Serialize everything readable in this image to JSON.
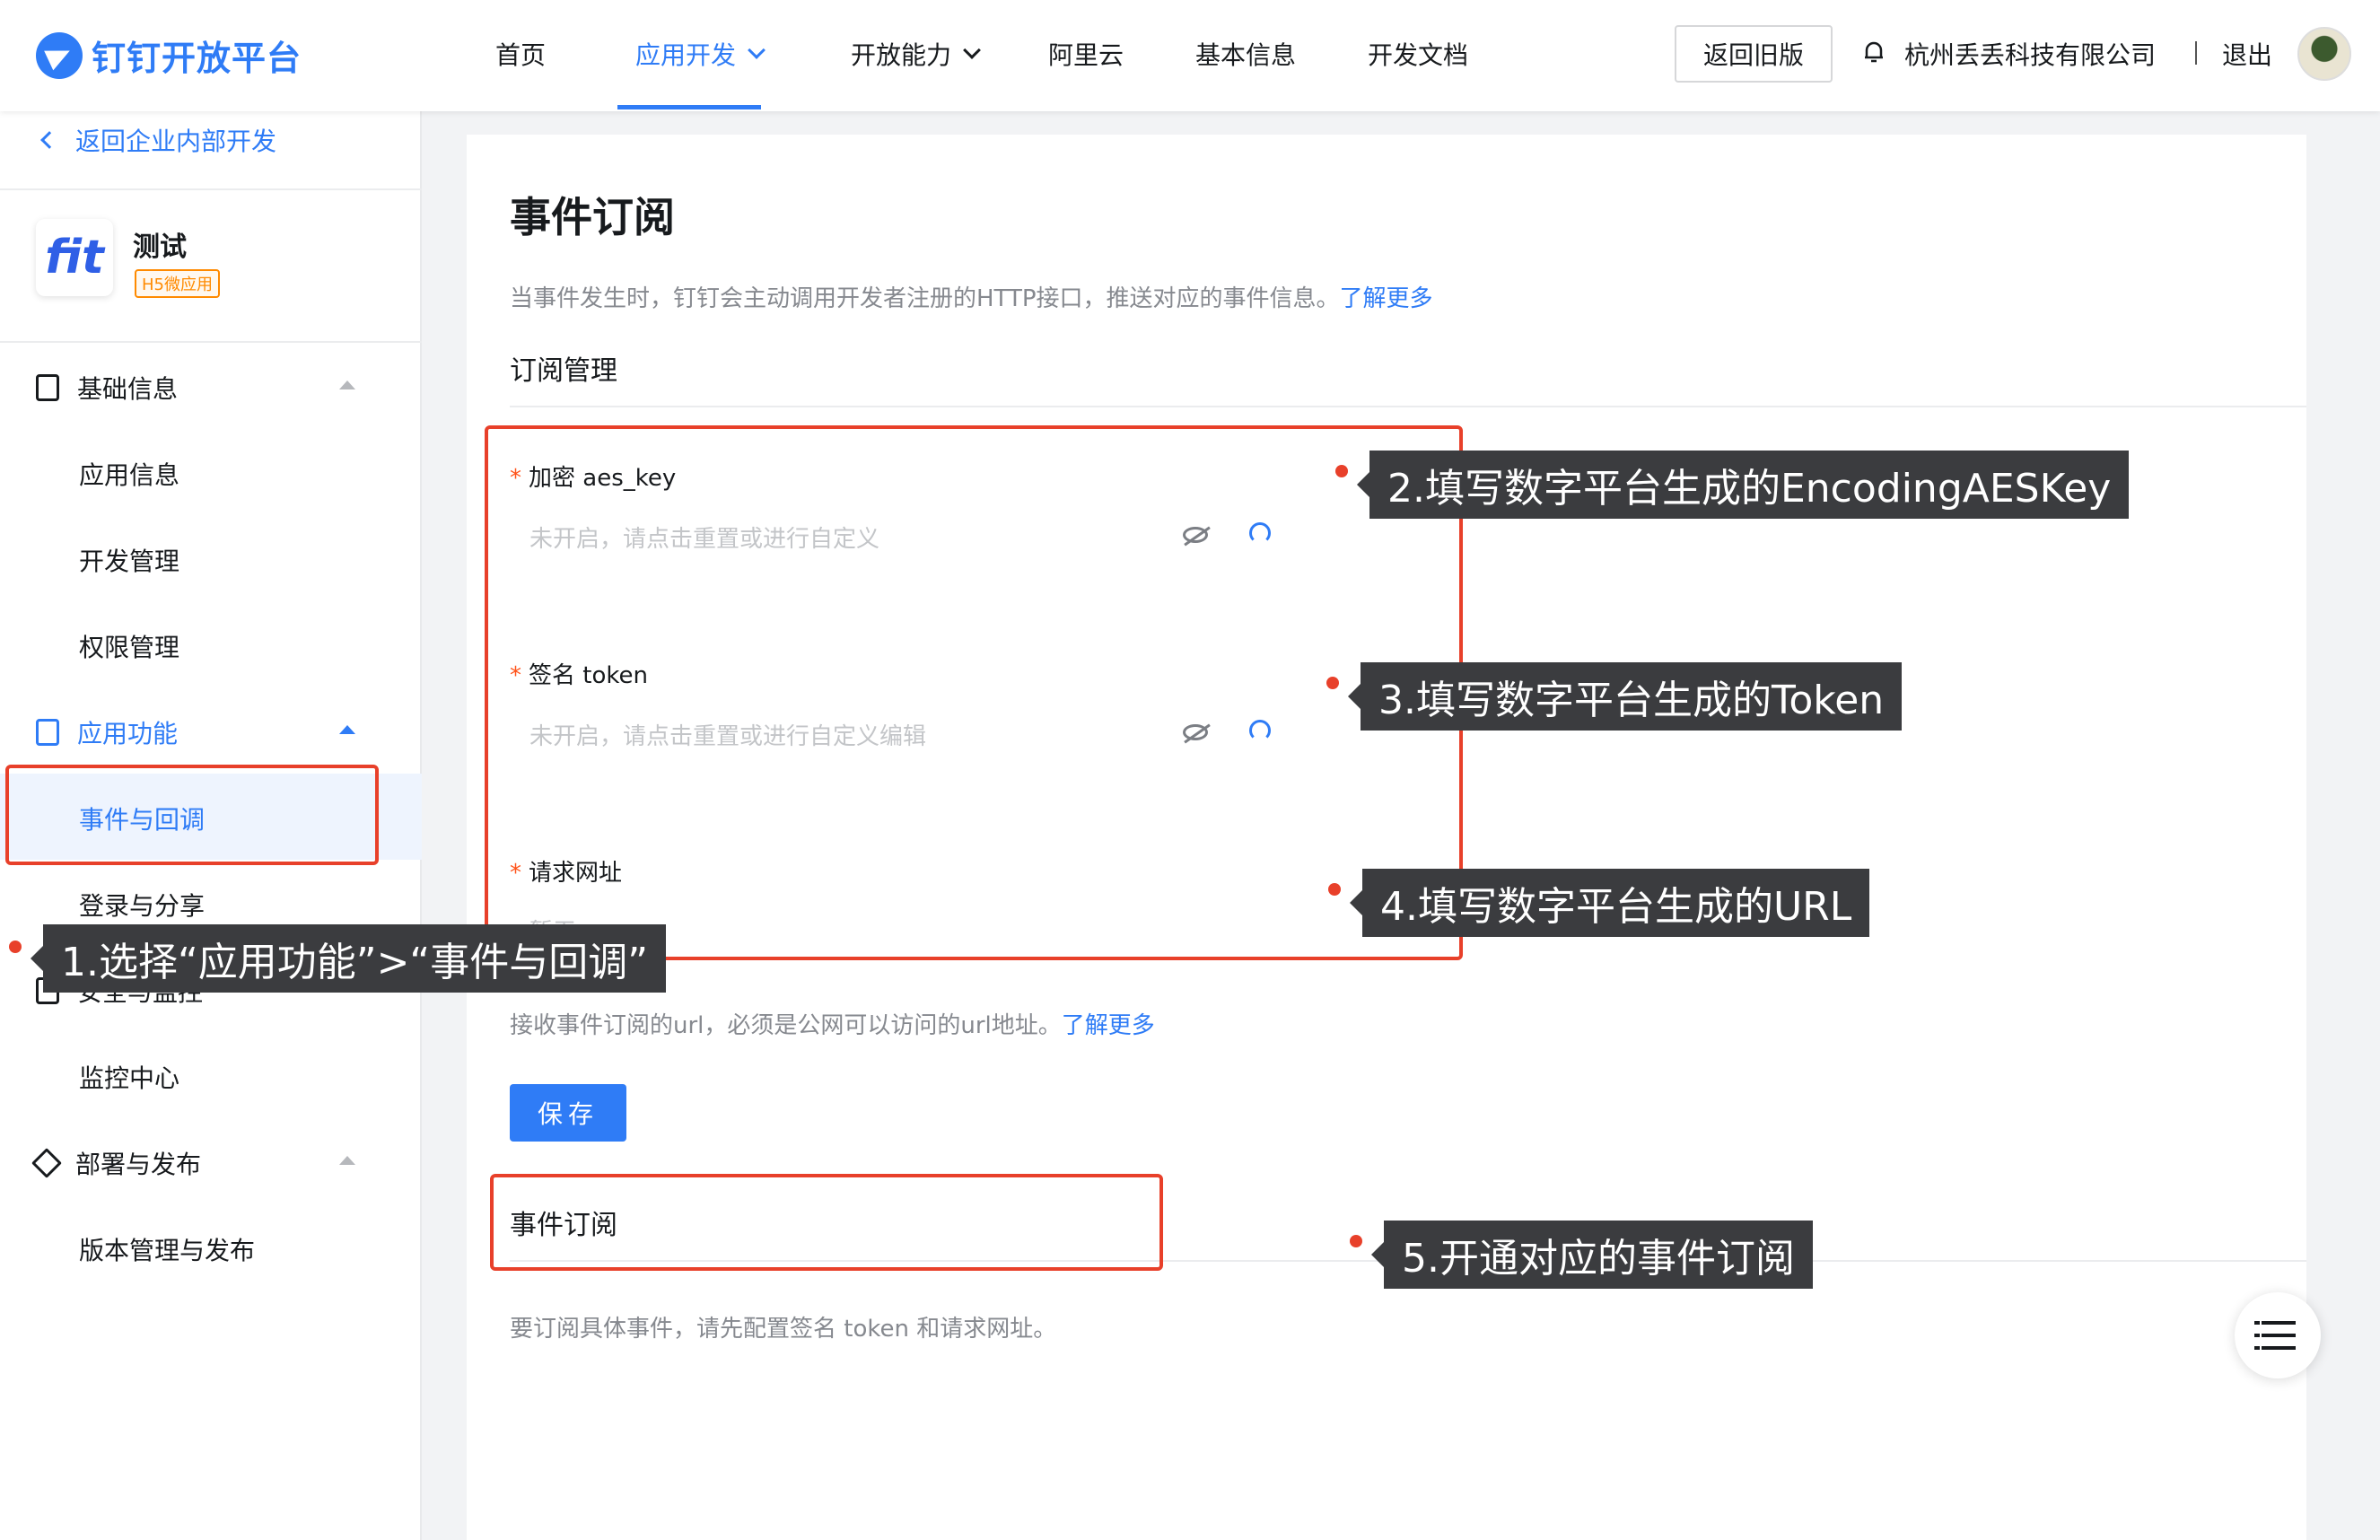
{
  "header": {
    "logo_text": "钉钉开放平台",
    "nav": {
      "home": "首页",
      "app_dev": "应用开发",
      "open_ability": "开放能力",
      "aliyun": "阿里云",
      "basic_info": "基本信息",
      "dev_docs": "开发文档"
    },
    "old_version_button": "返回旧版",
    "company": "杭州丢丢科技有限公司",
    "logout": "退出"
  },
  "sidebar": {
    "back_link": "返回企业内部开发",
    "app": {
      "name": "测试",
      "tag": "H5微应用",
      "icon_glyph": "fit"
    },
    "groups": {
      "basic": "基础信息",
      "func": "应用功能",
      "security": "安全与监控",
      "deploy": "部署与发布"
    },
    "items": {
      "app_info": "应用信息",
      "dev_manage": "开发管理",
      "perm_manage": "权限管理",
      "event_callback": "事件与回调",
      "login_share": "登录与分享",
      "monitor": "监控中心",
      "version": "版本管理与发布"
    }
  },
  "main": {
    "title": "事件订阅",
    "desc": "当事件发生时，钉钉会主动调用开发者注册的HTTP接口，推送对应的事件信息。",
    "learn_more": "了解更多",
    "subscription_manage": "订阅管理",
    "fields": {
      "aes_label": "加密 aes_key",
      "aes_placeholder": "未开启，请点击重置或进行自定义",
      "token_label": "签名 token",
      "token_placeholder": "未开启，请点击重置或进行自定义编辑",
      "url_label": "请求网址",
      "url_placeholder": "暂无"
    },
    "url_hint": "接收事件订阅的url，必须是公网可以访问的url地址。",
    "save": "保存",
    "event_subscription": "事件订阅",
    "sub_hint": "要订阅具体事件，请先配置签名 token 和请求网址。"
  },
  "annotations": {
    "step1": "1.选择“应用功能”>“事件与回调”",
    "step2": "2.填写数字平台生成的EncodingAESKey",
    "step3": "3.填写数字平台生成的Token",
    "step4": "4.填写数字平台生成的URL",
    "step5": "5.开通对应的事件订阅"
  },
  "colors": {
    "brand": "#2f7cf6",
    "annotation": "#e8402a",
    "required": "#ff5219"
  }
}
